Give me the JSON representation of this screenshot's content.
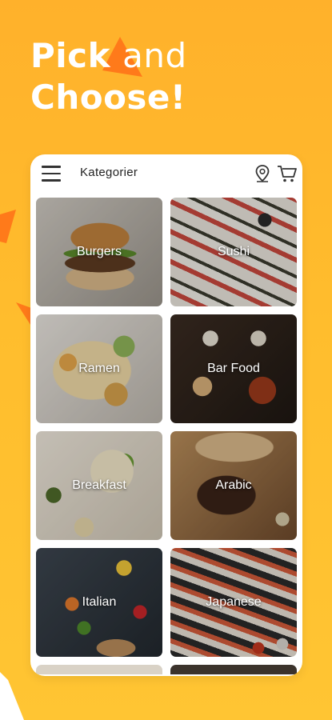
{
  "headline": {
    "line1_part1": "Pick ",
    "line1_part2": "and",
    "line2": "Choose!"
  },
  "appbar": {
    "title": "Kategorier",
    "icons": [
      "menu-icon",
      "location-pin-icon",
      "shopping-cart-icon"
    ]
  },
  "categories": [
    {
      "label": "Burgers"
    },
    {
      "label": "Sushi"
    },
    {
      "label": "Ramen"
    },
    {
      "label": "Bar Food"
    },
    {
      "label": "Breakfast"
    },
    {
      "label": "Arabic"
    },
    {
      "label": "Italian"
    },
    {
      "label": "Japanese"
    }
  ],
  "colors": {
    "background": "#ffb12b",
    "accent_orange": "#ff7a1a",
    "card_text": "#ffffff",
    "panel": "#ffffff"
  }
}
